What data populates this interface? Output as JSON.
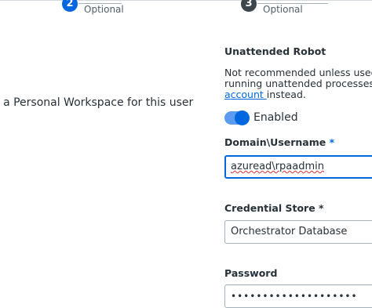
{
  "stepper": {
    "step2": {
      "number": "2",
      "optional_label": "Optional"
    },
    "step3": {
      "number": "3",
      "optional_label": "Optional"
    }
  },
  "left": {
    "workspace_text": "e a Personal Workspace for this user"
  },
  "unattended": {
    "title": "Unattended Robot",
    "desc_line1": "Not recommended unless used tc",
    "desc_line2": "running unattended processes or",
    "desc_link": "account ",
    "desc_after_link": "instead.",
    "toggle_label": "Enabled",
    "toggle_on": true
  },
  "fields": {
    "domain": {
      "label": "Domain\\Username",
      "required_mark": "*",
      "value": "azuread\\rpaadmin"
    },
    "credential_store": {
      "label": "Credential Store",
      "required_mark": "*",
      "value": "Orchestrator Database"
    },
    "password": {
      "label": "Password",
      "value": "••••••••••••••••••••"
    }
  },
  "colors": {
    "accent": "#0067df",
    "text": "#273139"
  }
}
